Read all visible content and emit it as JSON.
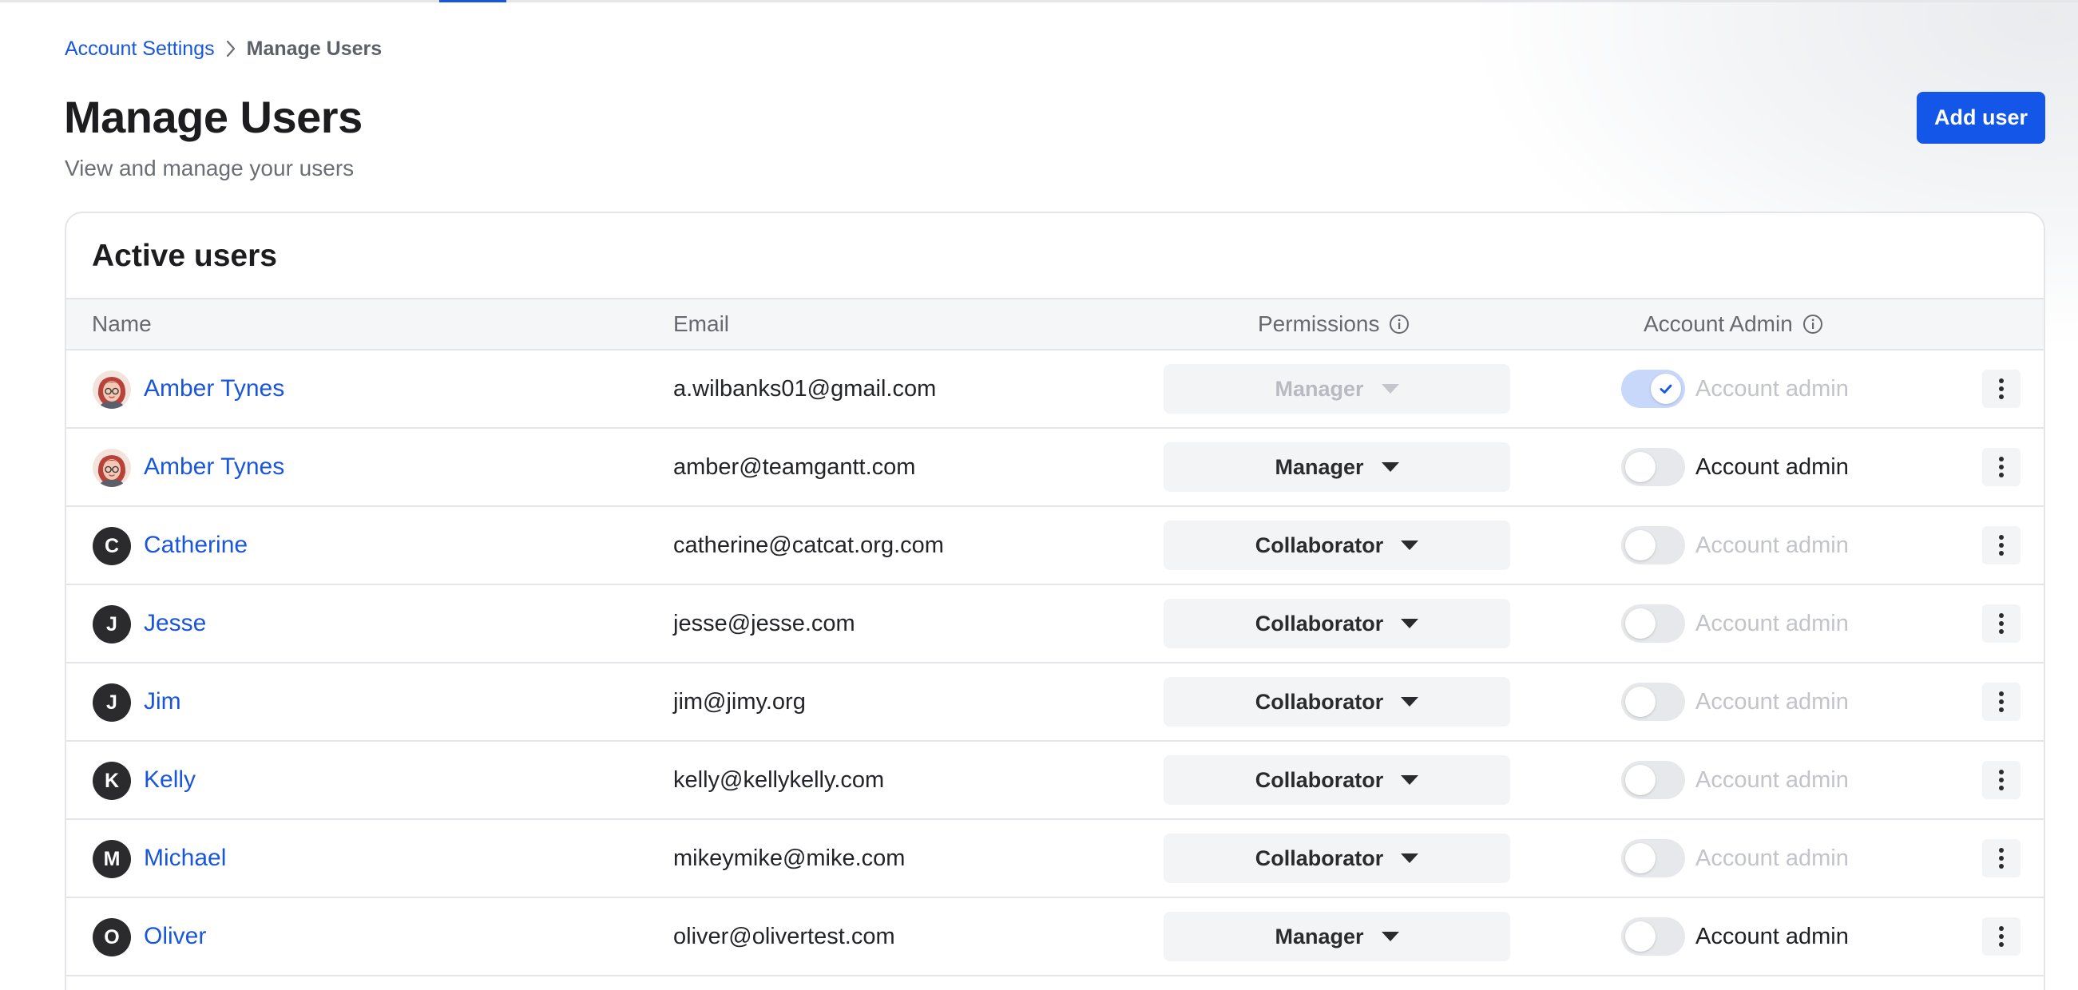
{
  "breadcrumb": {
    "parent": "Account Settings",
    "current": "Manage Users"
  },
  "header": {
    "title": "Manage Users",
    "subtitle": "View and manage your users",
    "add_user_label": "Add user"
  },
  "table": {
    "title": "Active users",
    "columns": {
      "name": "Name",
      "email": "Email",
      "permissions": "Permissions",
      "account_admin": "Account Admin"
    },
    "rows": [
      {
        "initial": "",
        "avatar": "photo-avatar",
        "name": "Amber Tynes",
        "email": "a.wilbanks01@gmail.com",
        "permission": "Manager",
        "permission_disabled": true,
        "admin_on": true,
        "admin_disabled": true,
        "admin_label": "Account admin"
      },
      {
        "initial": "",
        "avatar": "photo-avatar",
        "name": "Amber Tynes",
        "email": "amber@teamgantt.com",
        "permission": "Manager",
        "permission_disabled": false,
        "admin_on": false,
        "admin_disabled": false,
        "admin_label": "Account admin"
      },
      {
        "initial": "C",
        "avatar": "initial-avatar",
        "name": "Catherine",
        "email": "catherine@catcat.org.com",
        "permission": "Collaborator",
        "permission_disabled": false,
        "admin_on": false,
        "admin_disabled": true,
        "admin_label": "Account admin"
      },
      {
        "initial": "J",
        "avatar": "initial-avatar",
        "name": "Jesse",
        "email": "jesse@jesse.com",
        "permission": "Collaborator",
        "permission_disabled": false,
        "admin_on": false,
        "admin_disabled": true,
        "admin_label": "Account admin"
      },
      {
        "initial": "J",
        "avatar": "initial-avatar",
        "name": "Jim",
        "email": "jim@jimy.org",
        "permission": "Collaborator",
        "permission_disabled": false,
        "admin_on": false,
        "admin_disabled": true,
        "admin_label": "Account admin"
      },
      {
        "initial": "K",
        "avatar": "initial-avatar",
        "name": "Kelly",
        "email": "kelly@kellykelly.com",
        "permission": "Collaborator",
        "permission_disabled": false,
        "admin_on": false,
        "admin_disabled": true,
        "admin_label": "Account admin"
      },
      {
        "initial": "M",
        "avatar": "initial-avatar",
        "name": "Michael",
        "email": "mikeymike@mike.com",
        "permission": "Collaborator",
        "permission_disabled": false,
        "admin_on": false,
        "admin_disabled": true,
        "admin_label": "Account admin"
      },
      {
        "initial": "O",
        "avatar": "initial-avatar",
        "name": "Oliver",
        "email": "oliver@olivertest.com",
        "permission": "Manager",
        "permission_disabled": false,
        "admin_on": false,
        "admin_disabled": false,
        "admin_label": "Account admin"
      }
    ]
  },
  "icons": {
    "breadcrumb_separator": "chevron-right-icon",
    "column_info": "info-icon",
    "permission_caret": "caret-down-icon",
    "row_menu": "more-vertical-icon",
    "toggle_check": "check-icon"
  },
  "colors": {
    "accent": "#1457e8",
    "link": "#1a56db",
    "toggle_on": "#c7d8fb",
    "avatar_bg": "#2b2b2d"
  }
}
